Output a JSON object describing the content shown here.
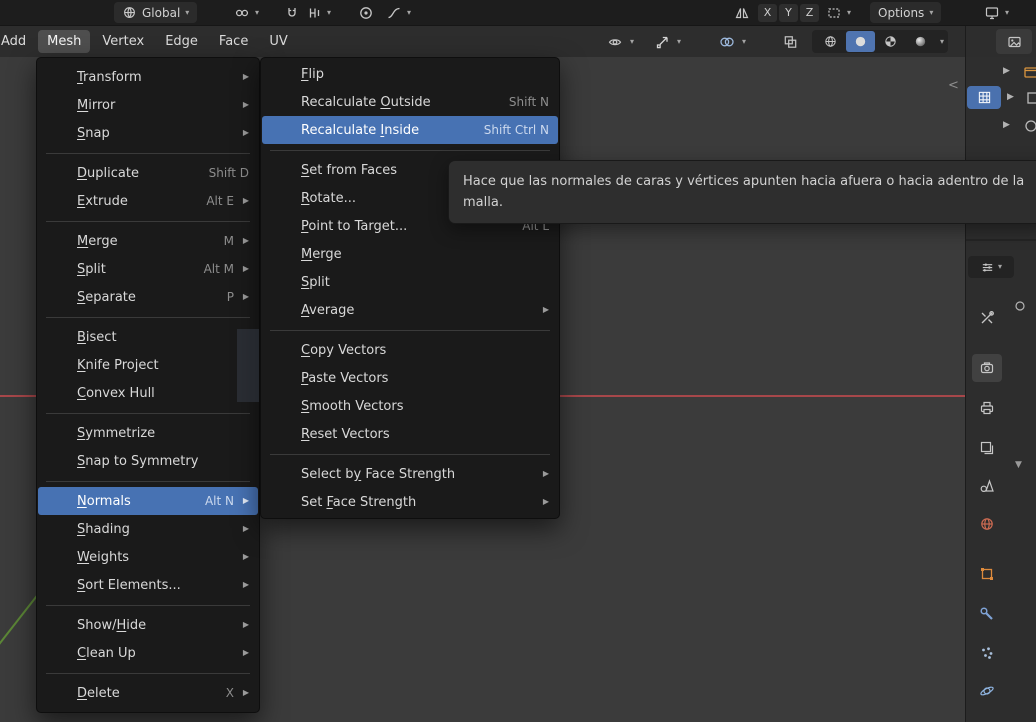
{
  "glyphs": {
    "chevron_down": "▾",
    "submenu_arrow": "▶",
    "expand_arrow": "▶",
    "dropdown_tri": "▼",
    "sidebar_toggle": "<"
  },
  "colors": {
    "accent_selection": "#4772b3",
    "axis_x": "#bb4a4e",
    "axis_y": "#5f8f36",
    "menu_bg": "#1a1a1a",
    "header_bg": "#2d2d2d",
    "topbar_bg": "#1d1d1d",
    "viewport_bg": "#3b3b3b"
  },
  "topbar": {
    "orientation": {
      "icon": "global-orientation-icon",
      "label": "Global"
    },
    "icons": [
      "pivot-point-icon",
      "magnet-icon",
      "snap-increment-icon",
      "proportional-editing-icon",
      "falloff-curve-icon",
      "mirror-icon",
      "dashed-box-icon",
      "display-settings-icon"
    ],
    "axis_buttons": [
      "X",
      "Y",
      "Z"
    ],
    "options_label": "Options"
  },
  "menubar": {
    "items": [
      {
        "label": "Add"
      },
      {
        "label": "Mesh",
        "active": true
      },
      {
        "label": "Vertex"
      },
      {
        "label": "Edge"
      },
      {
        "label": "Face"
      },
      {
        "label": "UV"
      }
    ],
    "right_icons": [
      "visibility-eye-icon",
      "gizmo-icon",
      "overlays-icon",
      "xray-icon"
    ],
    "shading_modes": [
      "wireframe",
      "solid",
      "material-preview",
      "rendered"
    ],
    "shading_active": "solid"
  },
  "mesh_menu": {
    "items": [
      {
        "label": "Transform",
        "accel": 0,
        "submenu": true
      },
      {
        "label": "Mirror",
        "accel": 0,
        "submenu": true
      },
      {
        "label": "Snap",
        "accel": 0,
        "submenu": true
      },
      {
        "sep": true
      },
      {
        "label": "Duplicate",
        "accel": 0,
        "shortcut": "Shift D"
      },
      {
        "label": "Extrude",
        "accel": 0,
        "shortcut": "Alt E",
        "submenu": true
      },
      {
        "sep": true
      },
      {
        "label": "Merge",
        "accel": 0,
        "shortcut": "M",
        "submenu": true
      },
      {
        "label": "Split",
        "accel": 0,
        "shortcut": "Alt M",
        "submenu": true
      },
      {
        "label": "Separate",
        "accel": 0,
        "shortcut": "P",
        "submenu": true
      },
      {
        "sep": true
      },
      {
        "label": "Bisect",
        "accel": 0
      },
      {
        "label": "Knife Project",
        "accel": 0
      },
      {
        "label": "Convex Hull",
        "accel": 0
      },
      {
        "sep": true
      },
      {
        "label": "Symmetrize",
        "accel": 0
      },
      {
        "label": "Snap to Symmetry",
        "accel": 0
      },
      {
        "sep": true
      },
      {
        "label": "Normals",
        "accel": 0,
        "shortcut": "Alt N",
        "submenu": true,
        "highlight": true
      },
      {
        "label": "Shading",
        "accel": 0,
        "submenu": true
      },
      {
        "label": "Weights",
        "accel": 0,
        "submenu": true
      },
      {
        "label": "Sort Elements...",
        "accel": 0,
        "submenu": true
      },
      {
        "sep": true
      },
      {
        "label": "Show/Hide",
        "accel": 5,
        "submenu": true
      },
      {
        "label": "Clean Up",
        "accel": 0,
        "submenu": true
      },
      {
        "sep": true
      },
      {
        "label": "Delete",
        "accel": 0,
        "shortcut": "X",
        "submenu": true
      }
    ]
  },
  "normals_submenu": {
    "items": [
      {
        "label": "Flip",
        "accel": 0
      },
      {
        "label": "Recalculate Outside",
        "accel": 12,
        "shortcut": "Shift N"
      },
      {
        "label": "Recalculate Inside",
        "accel": 12,
        "shortcut": "Shift Ctrl N",
        "highlight": true
      },
      {
        "sep": true
      },
      {
        "label": "Set from Faces",
        "accel": 0
      },
      {
        "label": "Rotate...",
        "accel": 0
      },
      {
        "label": "Point to Target...",
        "accel": 0,
        "shortcut": "Alt L"
      },
      {
        "label": "Merge",
        "accel": 0
      },
      {
        "label": "Split",
        "accel": 0
      },
      {
        "label": "Average",
        "accel": 0,
        "submenu": true
      },
      {
        "sep": true
      },
      {
        "label": "Copy Vectors",
        "accel": 0
      },
      {
        "label": "Paste Vectors",
        "accel": 0
      },
      {
        "label": "Smooth Vectors",
        "accel": 0
      },
      {
        "label": "Reset Vectors",
        "accel": 0
      },
      {
        "sep": true
      },
      {
        "label": "Select by Face Strength",
        "accel": 8,
        "submenu": true
      },
      {
        "label": "Set Face Strength",
        "accel": 4,
        "submenu": true
      }
    ]
  },
  "tooltip": {
    "text": "Hace que las normales de caras y vértices apunten hacia afuera o hacia adentro de la malla."
  },
  "outliner": {
    "rows": [
      {
        "expanded": false,
        "icon": "collection-icon"
      },
      {
        "expanded": false,
        "selected": true,
        "icon": "grid-icon"
      },
      {
        "expanded": false,
        "icon": "object-item-icon"
      }
    ]
  },
  "properties": {
    "editor_icon": "editor-type-sliders-icon",
    "tabs": [
      "tool",
      "render",
      "output",
      "view-layer",
      "scene",
      "world",
      "object",
      "modifiers",
      "particles",
      "physics"
    ],
    "active_tab": "render"
  }
}
